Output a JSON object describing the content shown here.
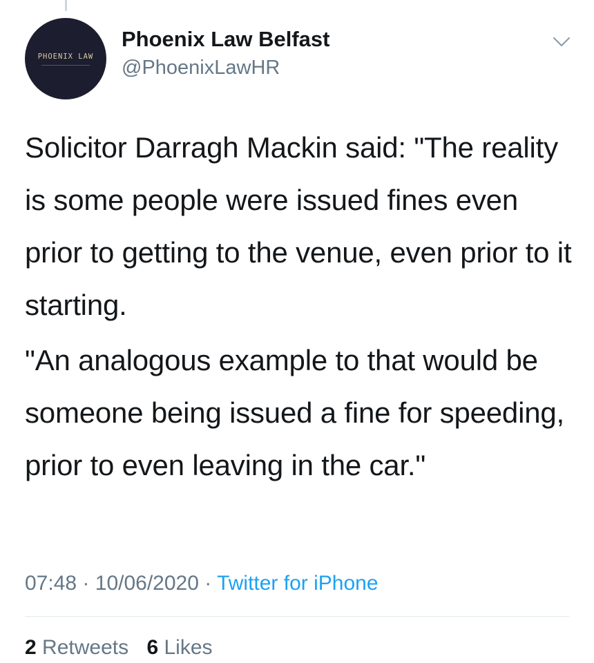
{
  "tweet": {
    "author": {
      "display_name": "Phoenix Law Belfast",
      "handle": "@PhoenixLawHR",
      "avatar_text": "PHOENIX LAW"
    },
    "paragraphs": [
      "Solicitor Darragh Mackin said: \"The reality is some people were issued fines even prior to getting to the venue, even prior to it starting.",
      "\"An analogous example to that would be someone being issued a fine for speeding, prior to even leaving in the car.\""
    ],
    "meta": {
      "time": "07:48",
      "separator": "·",
      "date": "10/06/2020",
      "source": "Twitter for iPhone"
    },
    "stats": {
      "retweets_count": "2",
      "retweets_label": "Retweets",
      "likes_count": "6",
      "likes_label": "Likes"
    },
    "menu_icon": "chevron-down-icon"
  },
  "colors": {
    "text_primary": "#14171a",
    "text_secondary": "#657786",
    "link": "#1da1f2",
    "avatar_bg": "#1d1d30"
  }
}
